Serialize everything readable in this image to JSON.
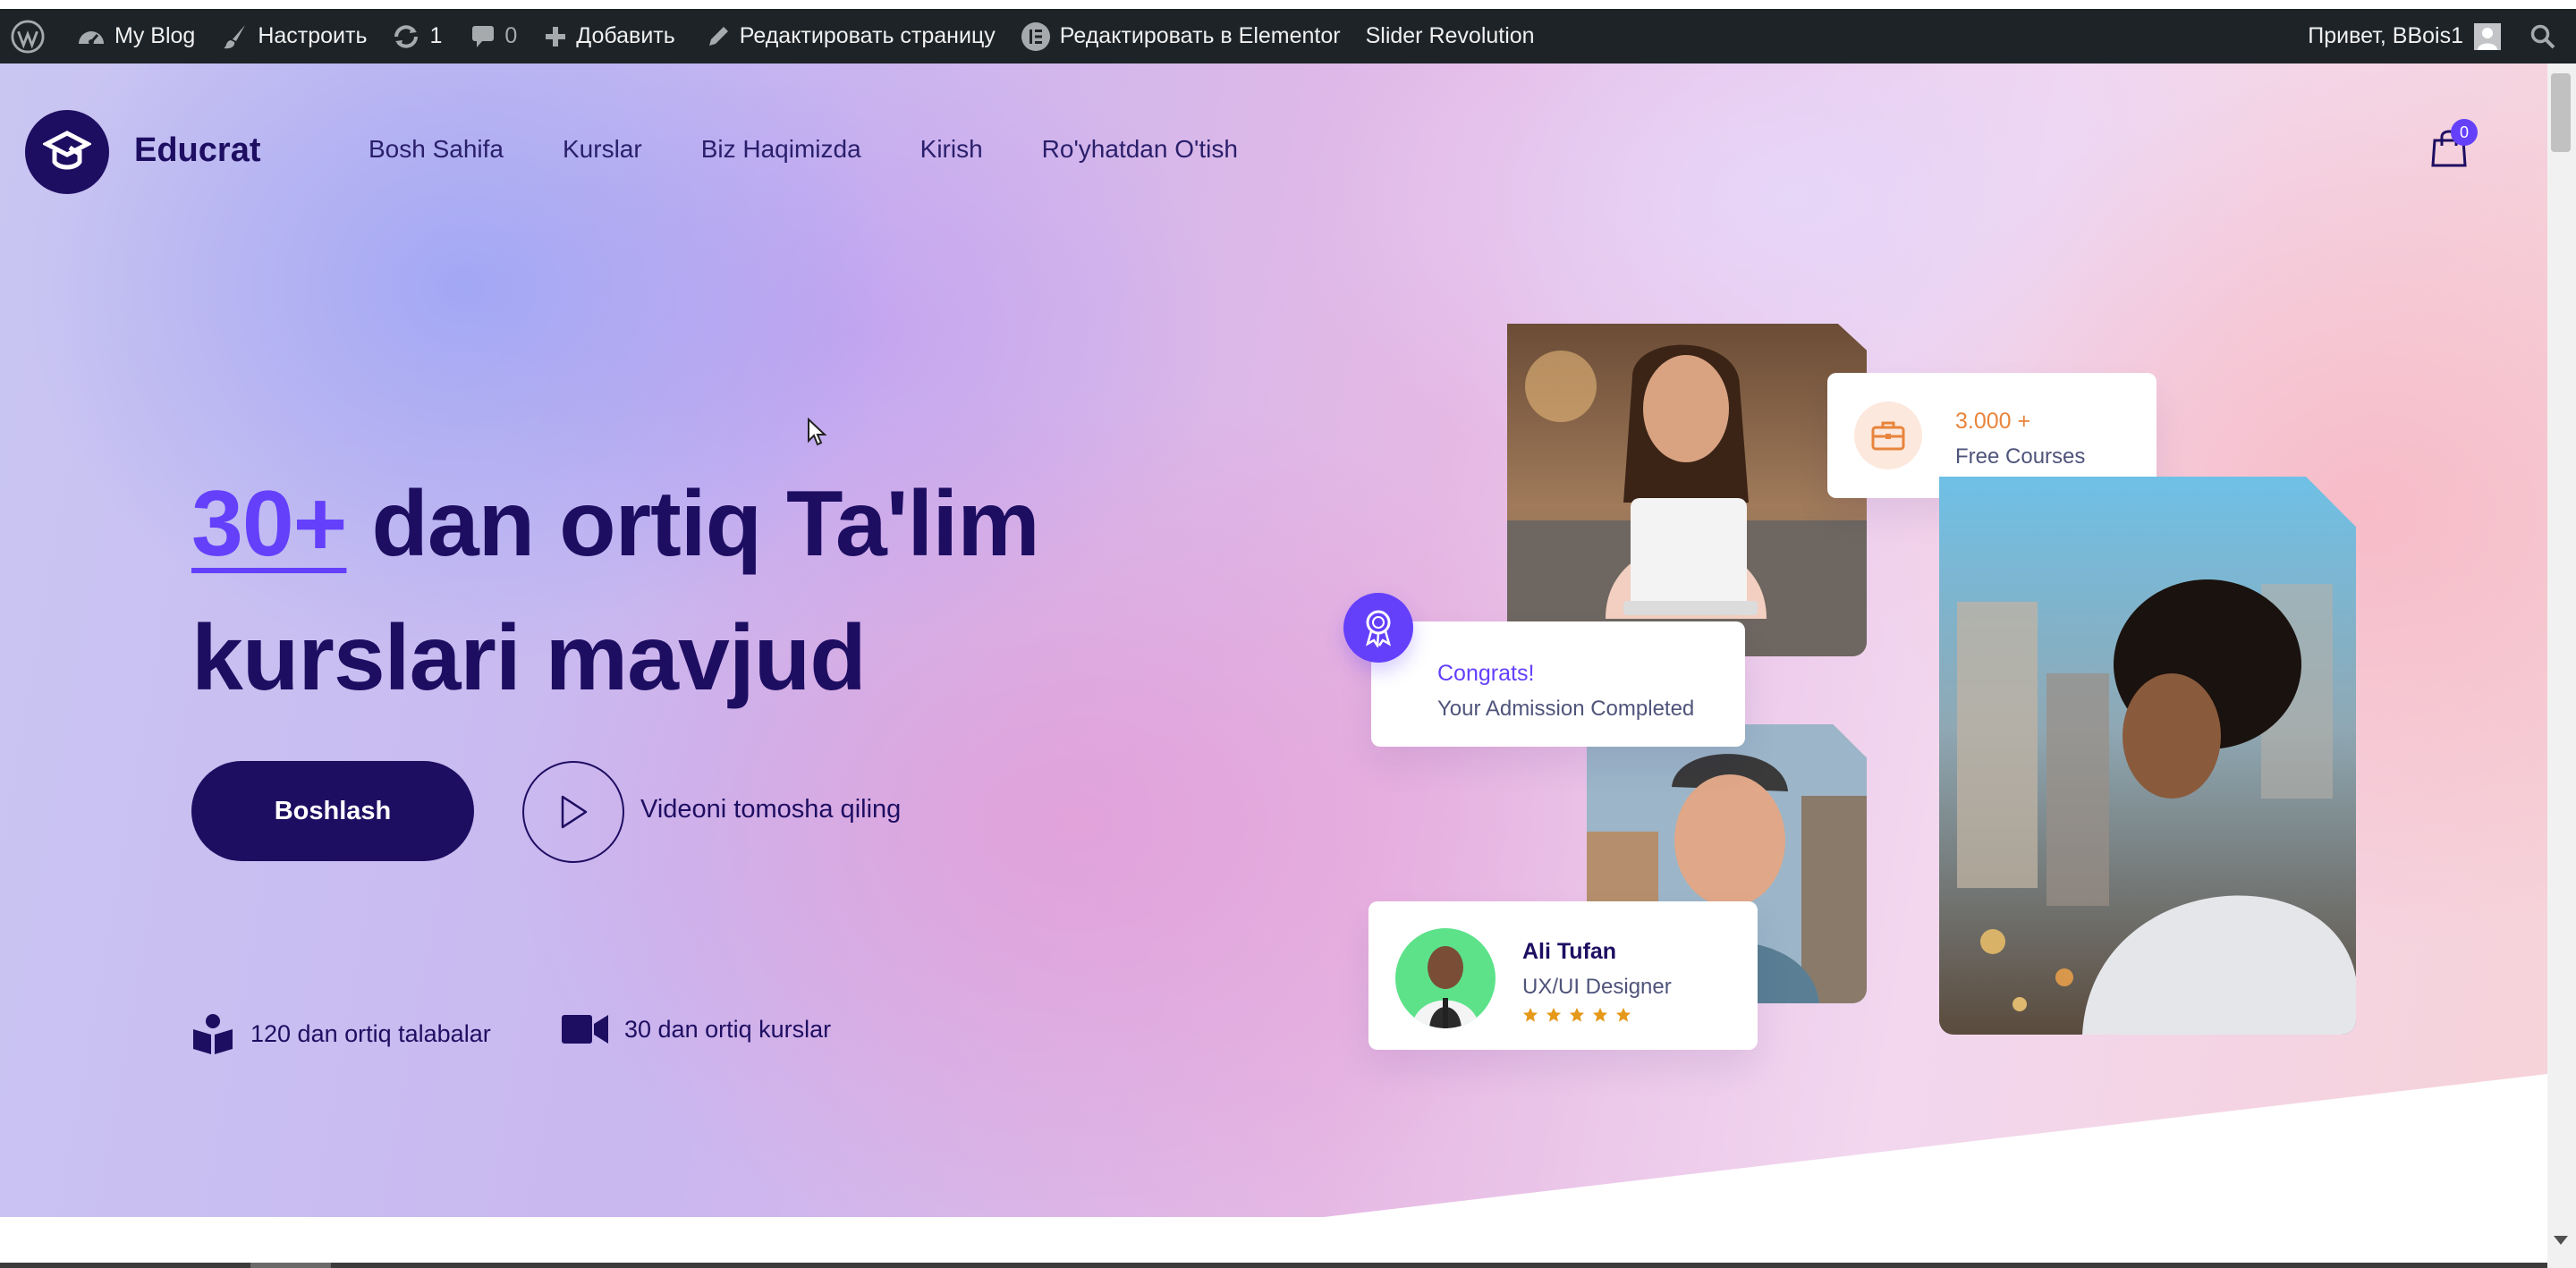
{
  "adminbar": {
    "site_name": "My Blog",
    "customize": "Настроить",
    "updates_count": "1",
    "comments_count": "0",
    "add_new": "Добавить",
    "edit_page": "Редактировать страницу",
    "edit_elementor": "Редактировать в Elementor",
    "slider_revolution": "Slider Revolution",
    "greeting": "Привет, BBois1",
    "icons": [
      "wordpress-icon",
      "dashboard-icon",
      "brush-icon",
      "updates-icon",
      "comment-icon",
      "plus-icon",
      "pencil-icon",
      "elementor-icon",
      "avatar",
      "search-icon"
    ]
  },
  "header": {
    "logo_text": "Educrat",
    "nav": [
      "Bosh Sahifa",
      "Kurslar",
      "Biz Haqimizda",
      "Kirish",
      "Ro'yhatdan O'tish"
    ],
    "cart_count": "0"
  },
  "hero": {
    "headline_accent": "30+",
    "headline_rest": " dan ortiq Ta'lim kurslari mavjud",
    "start_button": "Boshlash",
    "video_label": "Videoni tomosha qiling",
    "stats": [
      "120 dan ortiq talabalar",
      "30 dan ortiq kurslar"
    ]
  },
  "cards": {
    "courses_value": "3.000 +",
    "courses_label": "Free Courses",
    "congrats_title": "Congrats!",
    "congrats_text": "Your Admission Completed",
    "person_name": "Ali Tufan",
    "person_role": "UX/UI Designer",
    "rating_stars": 5
  },
  "colors": {
    "brand_dark": "#1e0e62",
    "accent_purple": "#6440fb",
    "accent_orange": "#e8843c",
    "star_orange": "#e59819"
  }
}
